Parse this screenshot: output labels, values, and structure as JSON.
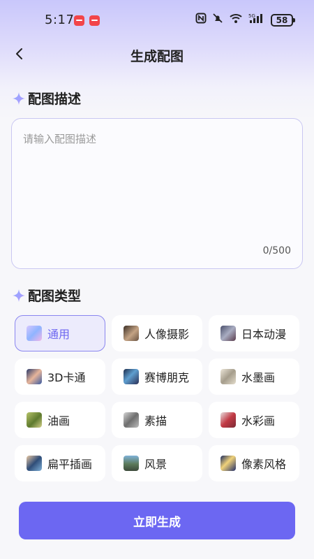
{
  "status_bar": {
    "time": "5:17",
    "battery": "58",
    "icons": [
      "nfc-icon",
      "mute-icon",
      "wifi-icon",
      "5g-signal-icon"
    ]
  },
  "nav": {
    "title": "生成配图"
  },
  "description_section": {
    "title": "配图描述",
    "placeholder": "请输入配图描述",
    "value": "",
    "counter": "0/500"
  },
  "type_section": {
    "title": "配图类型",
    "selected": "通用",
    "types": [
      {
        "label": "通用",
        "thumb_color": "#c8b8f8"
      },
      {
        "label": "人像摄影",
        "thumb_color": "#9a7d62"
      },
      {
        "label": "日本动漫",
        "thumb_color": "#6e7289"
      },
      {
        "label": "3D卡通",
        "thumb_color": "#4b5c87"
      },
      {
        "label": "赛博朋克",
        "thumb_color": "#3b5a85"
      },
      {
        "label": "水墨画",
        "thumb_color": "#d9d2c3"
      },
      {
        "label": "油画",
        "thumb_color": "#7c8b3b"
      },
      {
        "label": "素描",
        "thumb_color": "#9a9a9a"
      },
      {
        "label": "水彩画",
        "thumb_color": "#b8404a"
      },
      {
        "label": "扁平插画",
        "thumb_color": "#3f5a7e"
      },
      {
        "label": "风景",
        "thumb_color": "#5d7f8a"
      },
      {
        "label": "像素风格",
        "thumb_color": "#2f3f78"
      }
    ]
  },
  "generate_button": {
    "label": "立即生成"
  },
  "colors": {
    "accent": "#6c67f2",
    "selected_bg": "#ecebfc",
    "selected_border": "#8a86ef"
  }
}
